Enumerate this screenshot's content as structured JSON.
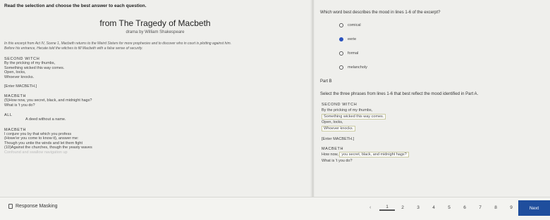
{
  "passage": {
    "instructions": "Read the selection and choose the best answer to each question.",
    "title": "from The Tragedy of Macbeth",
    "byline": "drama by William Shakespeare",
    "intro": [
      "In this excerpt from Act IV, Scene 1, Macbeth returns to the Weird Sisters for more prophecies and to discover who in court is plotting against him.",
      "Before his entrance, Hecate told the witches to fill Macbeth with a false sense of security."
    ],
    "witch_speaker": "SECOND WITCH",
    "witch_lines": [
      "By the pricking of my thumbs,",
      "Something wicked this way comes.",
      "Open, locks,",
      "Whoever knocks."
    ],
    "enter_direction": "[Enter MACBETH.]",
    "macbeth1_speaker": "MACBETH",
    "macbeth1_lines": [
      "(5)How now, you secret, black, and midnight hags?",
      "What is 't you do?"
    ],
    "all_speaker": "ALL",
    "all_line": "A deed without a name.",
    "macbeth2_speaker": "MACBETH",
    "macbeth2_lines": [
      "I conjure you by that which you profess",
      "(Howe'er you come to know it), answer me:",
      "Though you untie the winds and let them fight",
      "(10)Against the churches, though the yeasty waves",
      "Confound and swallow navigation up"
    ]
  },
  "question": {
    "prompt": "Which word best describes the mood in lines 1-6 of the excerpt?",
    "options": [
      {
        "label": "comical",
        "selected": false
      },
      {
        "label": "eerie",
        "selected": true
      },
      {
        "label": "formal",
        "selected": false
      },
      {
        "label": "melancholy",
        "selected": false
      }
    ],
    "part_label": "Part B",
    "part_b_prompt": "Select the three phrases from lines 1-6 that best reflect the mood identified in Part A.",
    "speaker": "SECOND WITCH",
    "line1": "By the pricking of my thumbs,",
    "line2": "Something wicked this way comes.",
    "line3": "Open, locks,",
    "line4": "Whoever knocks.",
    "enter": "[Enter MACBETH.]",
    "macbeth_speaker": "MACBETH",
    "line5_start": "How now,",
    "line5_highlight": "you secret, black, and midnight hags?",
    "line6": "What is 't you do?"
  },
  "footer": {
    "masking_label": "Response Masking",
    "prev_symbol": "‹",
    "pages": [
      "1",
      "2",
      "3",
      "4",
      "5",
      "6",
      "7",
      "8",
      "9",
      "10"
    ],
    "current_page": "1",
    "next_label": "Next"
  },
  "colors": {
    "accent": "#1f4e9d",
    "selected_radio": "#2a52be"
  }
}
